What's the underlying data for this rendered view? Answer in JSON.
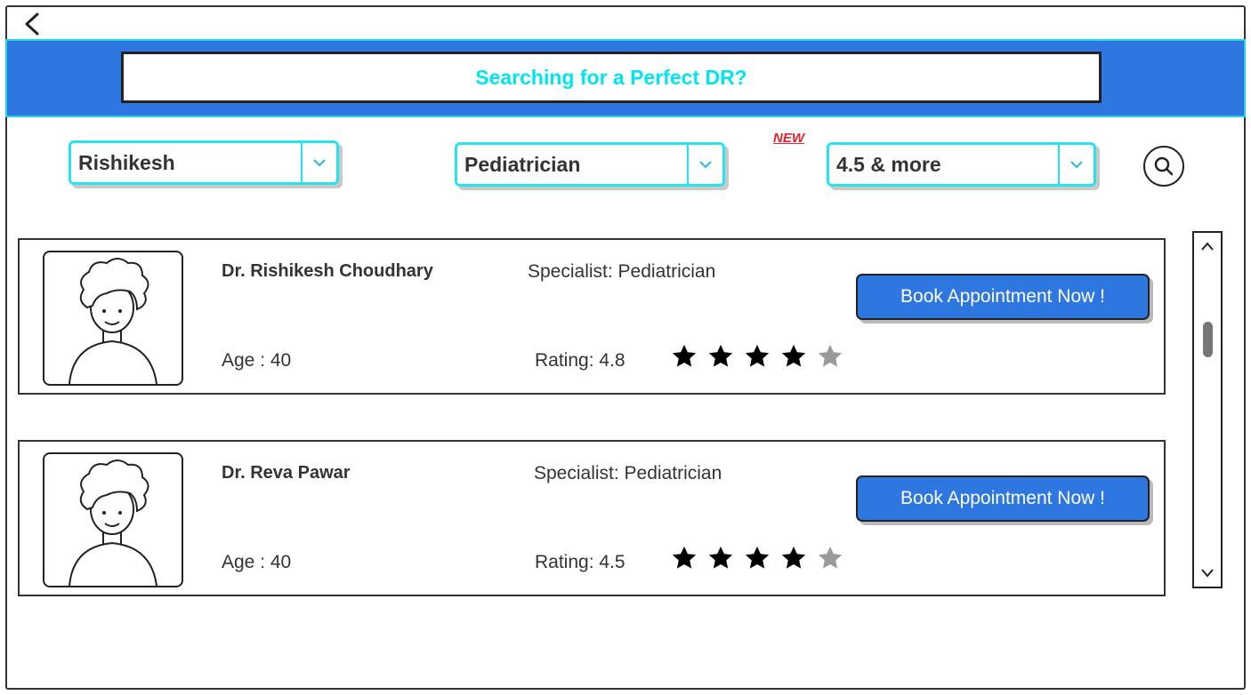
{
  "banner": {
    "title": "Searching for a Perfect DR?"
  },
  "filters": {
    "location": "Rishikesh",
    "specialty": "Pediatrician",
    "rating": "4.5 & more",
    "new_badge": "NEW"
  },
  "doctors": [
    {
      "name": "Dr. Rishikesh Choudhary",
      "specialist": "Specialist: Pediatrician",
      "age": "Age : 40",
      "rating_text": "Rating: 4.8",
      "stars_filled": 4,
      "stars_total": 5,
      "book_label": "Book Appointment Now !"
    },
    {
      "name": "Dr. Reva Pawar",
      "specialist": "Specialist: Pediatrician",
      "age": "Age : 40",
      "rating_text": "Rating: 4.5",
      "stars_filled": 4,
      "stars_total": 5,
      "book_label": "Book Appointment Now !"
    }
  ],
  "icons": {
    "back": "chevron-left-icon",
    "dropdown": "chevron-down-icon",
    "search": "search-icon",
    "star": "star-icon",
    "scroll_up": "chevron-up-icon",
    "scroll_down": "chevron-down-icon"
  },
  "colors": {
    "banner": "#2f77e0",
    "accent_cyan": "#27e3ef",
    "title_cyan": "#00e5f0",
    "button": "#2f77e0",
    "badge_red": "#e0232f",
    "star_filled": "#000000",
    "star_empty": "#9a9a9a"
  }
}
